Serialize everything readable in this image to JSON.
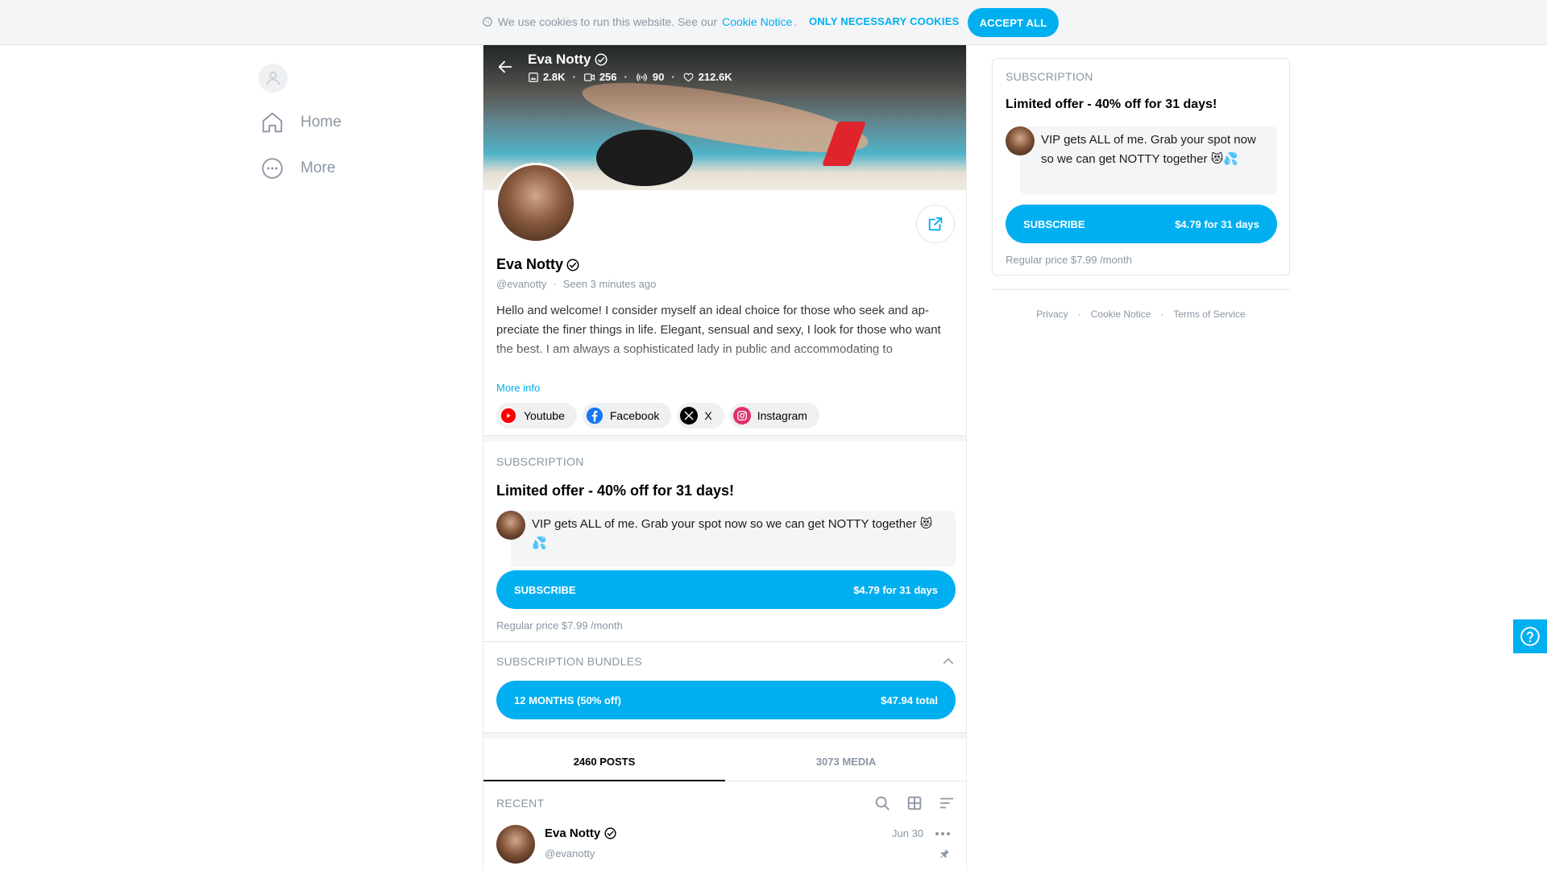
{
  "colors": {
    "accent": "#00aff0",
    "muted": "#8a96a3",
    "panel": "#f4f5f7"
  },
  "cookie_bar": {
    "text": "We use cookies to run this website. See our",
    "link": "Cookie Notice",
    "period": ".",
    "only_necessary": "ONLY NECESSARY COOKIES",
    "accept_all": "ACCEPT ALL"
  },
  "nav": {
    "items": [
      {
        "label": "Home",
        "icon": "home-icon"
      },
      {
        "label": "More",
        "icon": "more-circle-icon"
      }
    ]
  },
  "cover": {
    "name": "Eva Notty",
    "stats": [
      {
        "icon": "photo-icon",
        "value": "2.8K"
      },
      {
        "icon": "video-icon",
        "value": "256"
      },
      {
        "icon": "live-stream-icon",
        "value": "90"
      },
      {
        "icon": "heart-icon",
        "value": "212.6K"
      }
    ],
    "separator": "·"
  },
  "profile": {
    "name": "Eva Notty",
    "handle": "@evanotty",
    "separator": "·",
    "seen": "Seen  3 minutes ago",
    "bio": "Hello and welcome! I consider myself an ideal choice for those who seek and ap-preciate the finer things in life. Elegant, sensual and sexy, I look for those who want the best. I am always a sophisticated lady in public and accommodating to",
    "more_info": "More info",
    "socials": [
      {
        "label": "Youtube",
        "icon": "youtube-icon",
        "color": "#ff0000"
      },
      {
        "label": "Facebook",
        "icon": "facebook-icon",
        "color": "#1877f2"
      },
      {
        "label": "X",
        "icon": "x-icon",
        "color": "#000000"
      },
      {
        "label": "Instagram",
        "icon": "instagram-icon",
        "color": "#e1306c"
      }
    ]
  },
  "subscription": {
    "title": "SUBSCRIPTION",
    "offer": "Limited offer - 40% off for 31 days!",
    "message": "VIP gets ALL of me. Grab your spot now so we can get NOTTY together 😻💦",
    "button_label": "SUBSCRIBE",
    "button_price": "$4.79 for 31 days",
    "regular_price": "Regular price $7.99 /month"
  },
  "bundles": {
    "title": "SUBSCRIPTION BUNDLES",
    "items": [
      {
        "label": "12 MONTHS (50% off)",
        "price": "$47.94 total"
      }
    ]
  },
  "tabs": [
    {
      "label": "2460 POSTS",
      "active": true
    },
    {
      "label": "3073 MEDIA",
      "active": false
    }
  ],
  "feed": {
    "section": "RECENT",
    "post": {
      "name": "Eva Notty",
      "handle": "@evanotty",
      "date": "Jun 30"
    }
  },
  "right": {
    "title": "SUBSCRIPTION",
    "offer": "Limited offer - 40% off for 31 days!",
    "message": "VIP gets ALL of me. Grab your spot now so we can get NOTTY together 😻💦",
    "button_label": "SUBSCRIBE",
    "button_price": "$4.79 for 31 days",
    "regular_price": "Regular price $7.99 /month"
  },
  "footer": {
    "links": [
      "Privacy",
      "Cookie Notice",
      "Terms of Service"
    ],
    "separator": "·"
  }
}
